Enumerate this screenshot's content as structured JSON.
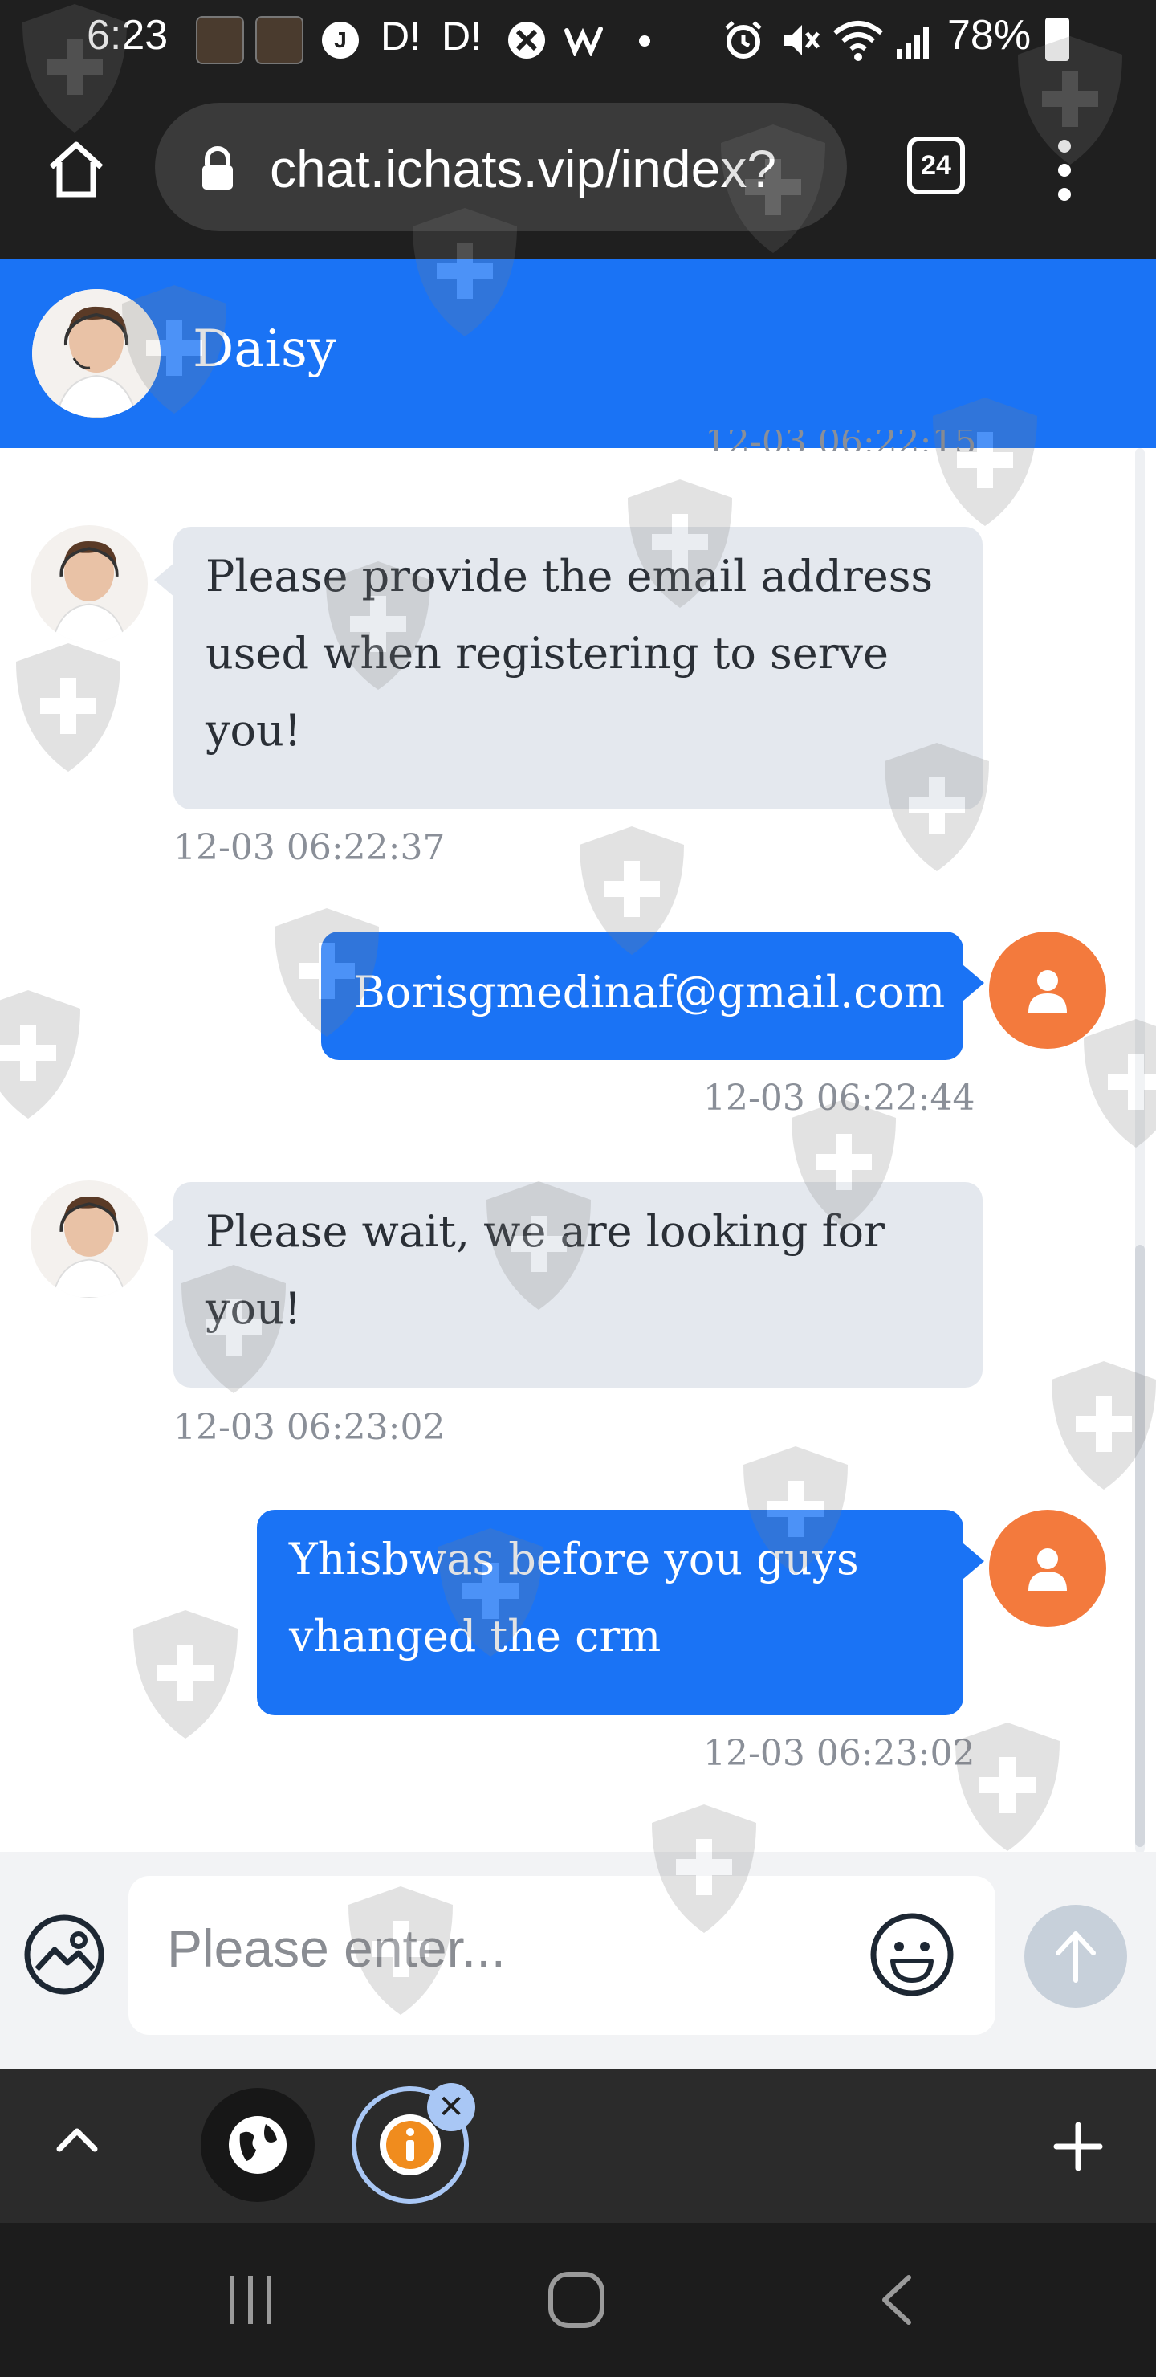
{
  "status_bar": {
    "time": "6:23",
    "notification_text_1": "D!",
    "notification_text_2": "D!",
    "battery_percent": "78%"
  },
  "browser": {
    "url": "chat.ichats.vip/index?",
    "tab_count": "24"
  },
  "chat": {
    "agent_name": "Daisy",
    "partial_timestamp": "12-03 06:22:15",
    "messages": [
      {
        "from": "agent",
        "lines": [
          "Please provide the email address",
          "used when registering to serve",
          "you!"
        ],
        "time": "12-03 06:22:37"
      },
      {
        "from": "user",
        "lines": [
          "Borisgmedinaf@gmail.com"
        ],
        "time": "12-03 06:22:44"
      },
      {
        "from": "agent",
        "lines": [
          "Please wait, we are looking for",
          "you!"
        ],
        "time": "12-03 06:23:02"
      },
      {
        "from": "user",
        "lines": [
          "Yhisbwas before you guys",
          "vhanged the crm"
        ],
        "time": "12-03 06:23:02"
      }
    ]
  },
  "composer": {
    "placeholder": "Please enter..."
  },
  "colors": {
    "header_blue": "#1a73f5",
    "user_avatar_orange": "#f37a3d",
    "agent_bubble": "#e4e8ee"
  },
  "icons": [
    "home-icon",
    "lock-icon",
    "menu-dots-icon",
    "image-upload-icon",
    "emoji-icon",
    "send-arrow-icon",
    "chevron-up-icon",
    "globe-icon",
    "info-icon",
    "close-icon",
    "plus-icon",
    "recents-icon",
    "home-nav-icon",
    "back-icon"
  ]
}
